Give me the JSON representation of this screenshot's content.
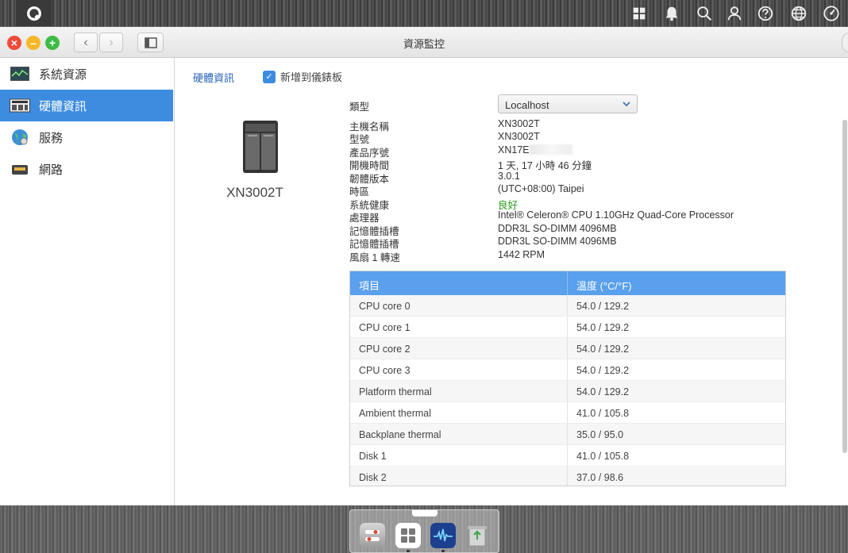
{
  "window": {
    "title": "資源監控"
  },
  "sidebar": {
    "items": [
      {
        "label": "系統資源",
        "icon": "chart-line-icon"
      },
      {
        "label": "硬體資訊",
        "icon": "hardware-icon",
        "active": true
      },
      {
        "label": "服務",
        "icon": "globe-icon"
      },
      {
        "label": "網路",
        "icon": "network-icon"
      }
    ]
  },
  "content": {
    "tab_label": "硬體資訊",
    "add_to_dashboard_label": "新增到儀錶板",
    "add_to_dashboard_checked": true,
    "device_name": "XN3002T",
    "type_label": "類型",
    "type_value": "Localhost",
    "info": [
      {
        "label": "主機名稱",
        "value": "XN3002T"
      },
      {
        "label": "型號",
        "value": "XN3002T"
      },
      {
        "label": "產品序號",
        "value": "XN17E"
      },
      {
        "label": "開機時間",
        "value": "1 天, 17 小時 46 分鐘"
      },
      {
        "label": "韌體版本",
        "value": "3.0.1"
      },
      {
        "label": "時區",
        "value": "(UTC+08:00) Taipei"
      },
      {
        "label": "系統健康",
        "value": "良好"
      },
      {
        "label": "處理器",
        "value": "Intel® Celeron® CPU 1.10GHz Quad-Core Processor"
      },
      {
        "label": "記憶體插槽",
        "value": "DDR3L SO-DIMM 4096MB"
      },
      {
        "label": "記憶體插槽",
        "value": "DDR3L SO-DIMM 4096MB"
      },
      {
        "label": "風扇 1 轉速",
        "value": "1442 RPM"
      }
    ],
    "table": {
      "headers": [
        "項目",
        "溫度 (°C/°F)"
      ],
      "rows": [
        [
          "CPU core 0",
          "54.0 / 129.2"
        ],
        [
          "CPU core 1",
          "54.0 / 129.2"
        ],
        [
          "CPU core 2",
          "54.0 / 129.2"
        ],
        [
          "CPU core 3",
          "54.0 / 129.2"
        ],
        [
          "Platform thermal",
          "54.0 / 129.2"
        ],
        [
          "Ambient thermal",
          "41.0 / 105.8"
        ],
        [
          "Backplane thermal",
          "35.0 / 95.0"
        ],
        [
          "Disk 1",
          "41.0 / 105.8"
        ],
        [
          "Disk 2",
          "37.0 / 98.6"
        ]
      ]
    }
  },
  "colors": {
    "accent": "#3d8ce0",
    "table_header": "#5aa0ec",
    "healthy": "#2a9a1e"
  }
}
